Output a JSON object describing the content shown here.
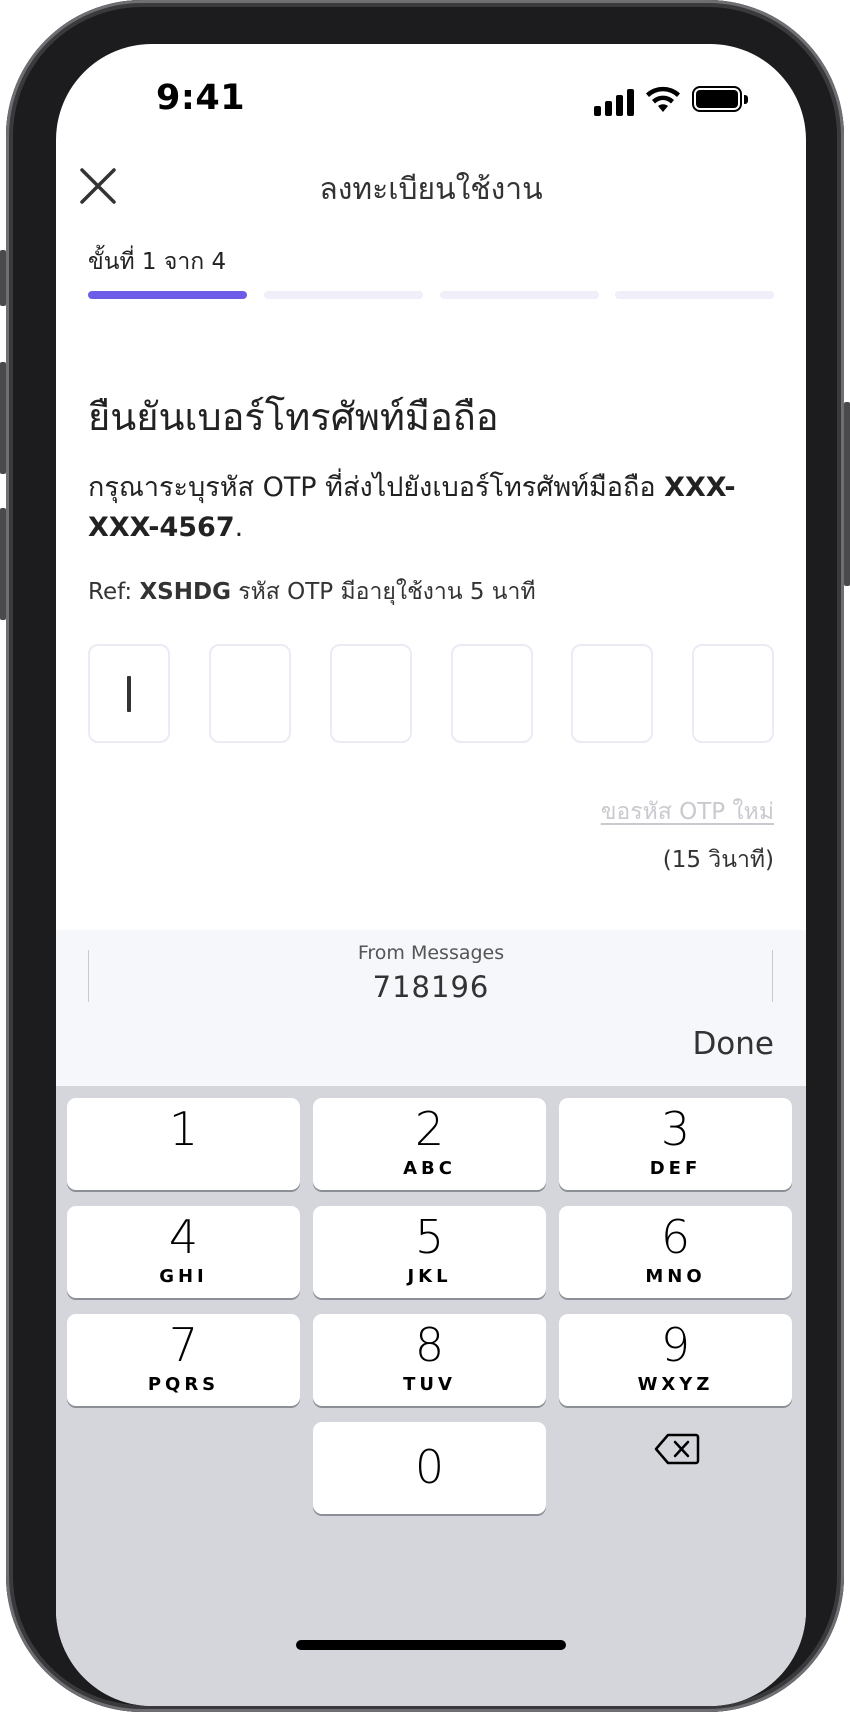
{
  "status_bar": {
    "time": "9:41"
  },
  "header": {
    "title": "ลงทะเบียนใช้งาน"
  },
  "progress": {
    "step_label": "ขั้นที่ 1 จาก 4",
    "total_steps": 4,
    "current_step": 1
  },
  "main": {
    "heading": "ยืนยันเบอร์โทรศัพท์มือถือ",
    "description_prefix": "กรุณาระบุรหัส OTP ที่ส่งไปยังเบอร์โทรศัพท์มือถือ ",
    "phone_masked": "XXX-XXX-4567",
    "description_suffix": ".",
    "ref_label": "Ref: ",
    "ref_code": "XSHDG",
    "ref_note": " รหัส OTP มีอายุใช้งาน 5 นาที",
    "resend_label": "ขอรหัส OTP ใหม่",
    "resend_timer": "(15 วินาที)"
  },
  "accessory": {
    "suggestion_source": "From Messages",
    "suggestion_code": "718196",
    "done_label": "Done"
  },
  "keyboard": {
    "keys": [
      {
        "num": "1",
        "letters": ""
      },
      {
        "num": "2",
        "letters": "ABC"
      },
      {
        "num": "3",
        "letters": "DEF"
      },
      {
        "num": "4",
        "letters": "GHI"
      },
      {
        "num": "5",
        "letters": "JKL"
      },
      {
        "num": "6",
        "letters": "MNO"
      },
      {
        "num": "7",
        "letters": "PQRS"
      },
      {
        "num": "8",
        "letters": "TUV"
      },
      {
        "num": "9",
        "letters": "WXYZ"
      },
      {
        "num": "0",
        "letters": ""
      }
    ]
  },
  "colors": {
    "accent": "#6c5ce7",
    "progress_inactive": "#efeef9",
    "keyboard_bg": "#d4d6dc"
  },
  "icons": {
    "close": "close-icon",
    "backspace": "backspace-icon"
  }
}
